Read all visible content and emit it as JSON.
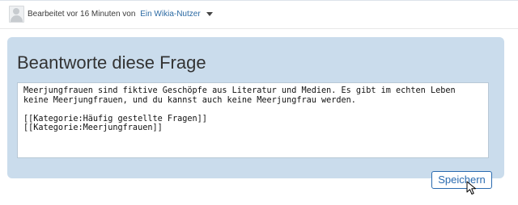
{
  "header": {
    "edited_text": "Bearbeitet vor 16 Minuten von",
    "user_name": "Ein Wikia-Nutzer"
  },
  "answer_panel": {
    "title": "Beantworte diese Frage",
    "text": "Meerjungfrauen sind fiktive Geschöpfe aus Literatur und Medien. Es gibt im echten Leben\nkeine Meerjungfrauen, und du kannst auch keine Meerjungfrau werden.\n\n[[Kategorie:Häufig gestellte Fragen]]\n[[Kategorie:Meerjungfrauen]]",
    "save_label": "Speichern"
  },
  "icons": {
    "avatar": "avatar-icon",
    "dropdown": "chevron-down-icon",
    "pointer": "mouse-cursor-icon"
  }
}
